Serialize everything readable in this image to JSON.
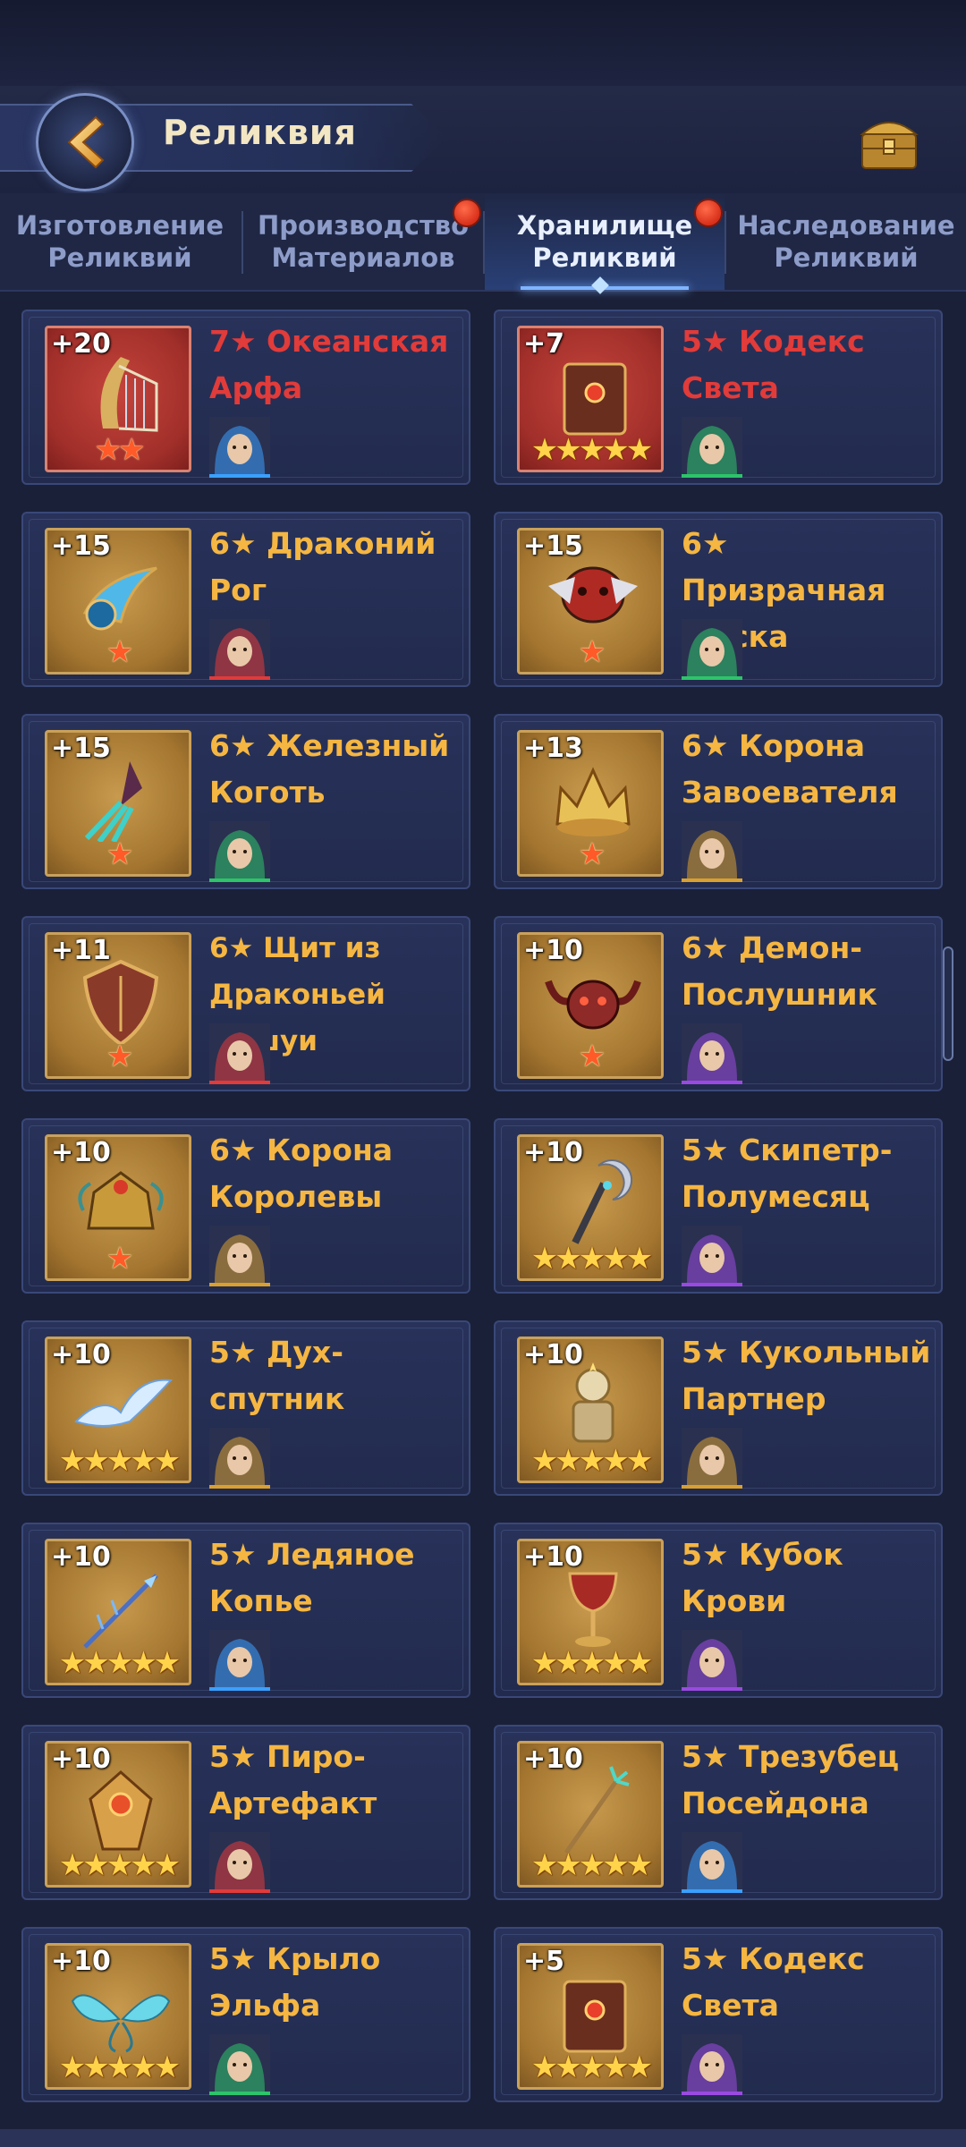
{
  "header": {
    "title": "Реликвия",
    "back_icon": "back-arrow-icon",
    "chest_icon": "treasure-chest-icon"
  },
  "tabs": [
    {
      "label": "Изготовление\nРеликвий",
      "active": false,
      "badge": false
    },
    {
      "label": "Производство\nМатериалов",
      "active": false,
      "badge": true
    },
    {
      "label": "Хранилище\nРеликвий",
      "active": true,
      "badge": true
    },
    {
      "label": "Наследование\nРеликвий",
      "active": false,
      "badge": false
    }
  ],
  "relics": [
    {
      "level": "+20",
      "name": "7★ Океанская\nАрфа",
      "thumb_stars": "★★",
      "frame": "red",
      "name_color": "red",
      "art": "harp-icon",
      "hero_color": "#3aa0ff",
      "stars_shown": 2
    },
    {
      "level": "+7",
      "name": "5★ Кодекс\nСвета",
      "thumb_stars": "★★★★★",
      "frame": "red",
      "name_color": "red",
      "art": "codex-icon",
      "hero_color": "#2dc46a",
      "stars_shown": 5
    },
    {
      "level": "+15",
      "name": "6★ Драконий\nРог",
      "thumb_stars": "★",
      "frame": "gold",
      "name_color": "gold",
      "art": "horn-icon",
      "hero_color": "#e13b3a",
      "stars_shown": 1
    },
    {
      "level": "+15",
      "name": "6★ Призрачная\nМаска",
      "thumb_stars": "★",
      "frame": "gold",
      "name_color": "gold",
      "art": "mask-icon",
      "hero_color": "#2dc46a",
      "stars_shown": 1
    },
    {
      "level": "+15",
      "name": "6★ Железный\nКоготь",
      "thumb_stars": "★",
      "frame": "gold",
      "name_color": "gold",
      "art": "claw-icon",
      "hero_color": "#2dc46a",
      "stars_shown": 1
    },
    {
      "level": "+13",
      "name": "6★ Корона\nЗавоевателя",
      "thumb_stars": "★",
      "frame": "gold",
      "name_color": "gold",
      "art": "crown-icon",
      "hero_color": "#d9a030",
      "stars_shown": 1
    },
    {
      "level": "+11",
      "name": "6★ Щит из\nДраконьей Чешуи",
      "thumb_stars": "★",
      "frame": "gold",
      "name_color": "gold",
      "art": "shield-icon",
      "hero_color": "#e13b3a",
      "stars_shown": 1
    },
    {
      "level": "+10",
      "name": "6★ Демон-\nПослушник",
      "thumb_stars": "★",
      "frame": "gold",
      "name_color": "gold",
      "art": "demon-skull-icon",
      "hero_color": "#9a4ae0",
      "stars_shown": 1
    },
    {
      "level": "+10",
      "name": "6★ Корона\nКоролевы",
      "thumb_stars": "★",
      "frame": "gold",
      "name_color": "gold",
      "art": "queen-crown-icon",
      "hero_color": "#d9a030",
      "stars_shown": 1
    },
    {
      "level": "+10",
      "name": "5★ Скипетр-\nПолумесяц",
      "thumb_stars": "★★★★★",
      "frame": "gold",
      "name_color": "gold",
      "art": "scepter-icon",
      "hero_color": "#9a4ae0",
      "stars_shown": 5
    },
    {
      "level": "+10",
      "name": "5★ Дух-спутник",
      "thumb_stars": "★★★★★",
      "frame": "gold",
      "name_color": "gold",
      "art": "spirit-bird-icon",
      "hero_color": "#d9a030",
      "stars_shown": 5
    },
    {
      "level": "+10",
      "name": "5★ Кукольный\nПартнер",
      "thumb_stars": "★★★★★",
      "frame": "gold",
      "name_color": "gold",
      "art": "doll-icon",
      "hero_color": "#d9a030",
      "stars_shown": 5
    },
    {
      "level": "+10",
      "name": "5★ Ледяное\nКопье",
      "thumb_stars": "★★★★★",
      "frame": "gold",
      "name_color": "gold",
      "art": "spear-icon",
      "hero_color": "#3aa0ff",
      "stars_shown": 5
    },
    {
      "level": "+10",
      "name": "5★ Кубок\nКрови",
      "thumb_stars": "★★★★★",
      "frame": "gold",
      "name_color": "gold",
      "art": "goblet-icon",
      "hero_color": "#9a4ae0",
      "stars_shown": 5
    },
    {
      "level": "+10",
      "name": "5★ Пиро-\nАртефакт",
      "thumb_stars": "★★★★★",
      "frame": "gold",
      "name_color": "gold",
      "art": "pyro-artifact-icon",
      "hero_color": "#e13b3a",
      "stars_shown": 5
    },
    {
      "level": "+10",
      "name": "5★ Трезубец\nПосейдона",
      "thumb_stars": "★★★★★",
      "frame": "gold",
      "name_color": "gold",
      "art": "trident-icon",
      "hero_color": "#3aa0ff",
      "stars_shown": 5
    },
    {
      "level": "+10",
      "name": "5★ Крыло\nЭльфа",
      "thumb_stars": "★★★★★",
      "frame": "gold",
      "name_color": "gold",
      "art": "wing-icon",
      "hero_color": "#2dc46a",
      "stars_shown": 5
    },
    {
      "level": "+5",
      "name": "5★ Кодекс\nСвета",
      "thumb_stars": "★★★★★",
      "frame": "gold",
      "name_color": "gold",
      "art": "codex-icon",
      "hero_color": "#9a4ae0",
      "stars_shown": 5
    }
  ],
  "colors": {
    "background": "#1a2038",
    "card": "#28325a",
    "gold_text": "#f5b642",
    "red_text": "#e13b3a",
    "active_tab": "#e8f0ff",
    "inactive_tab": "#8d9cc8"
  }
}
